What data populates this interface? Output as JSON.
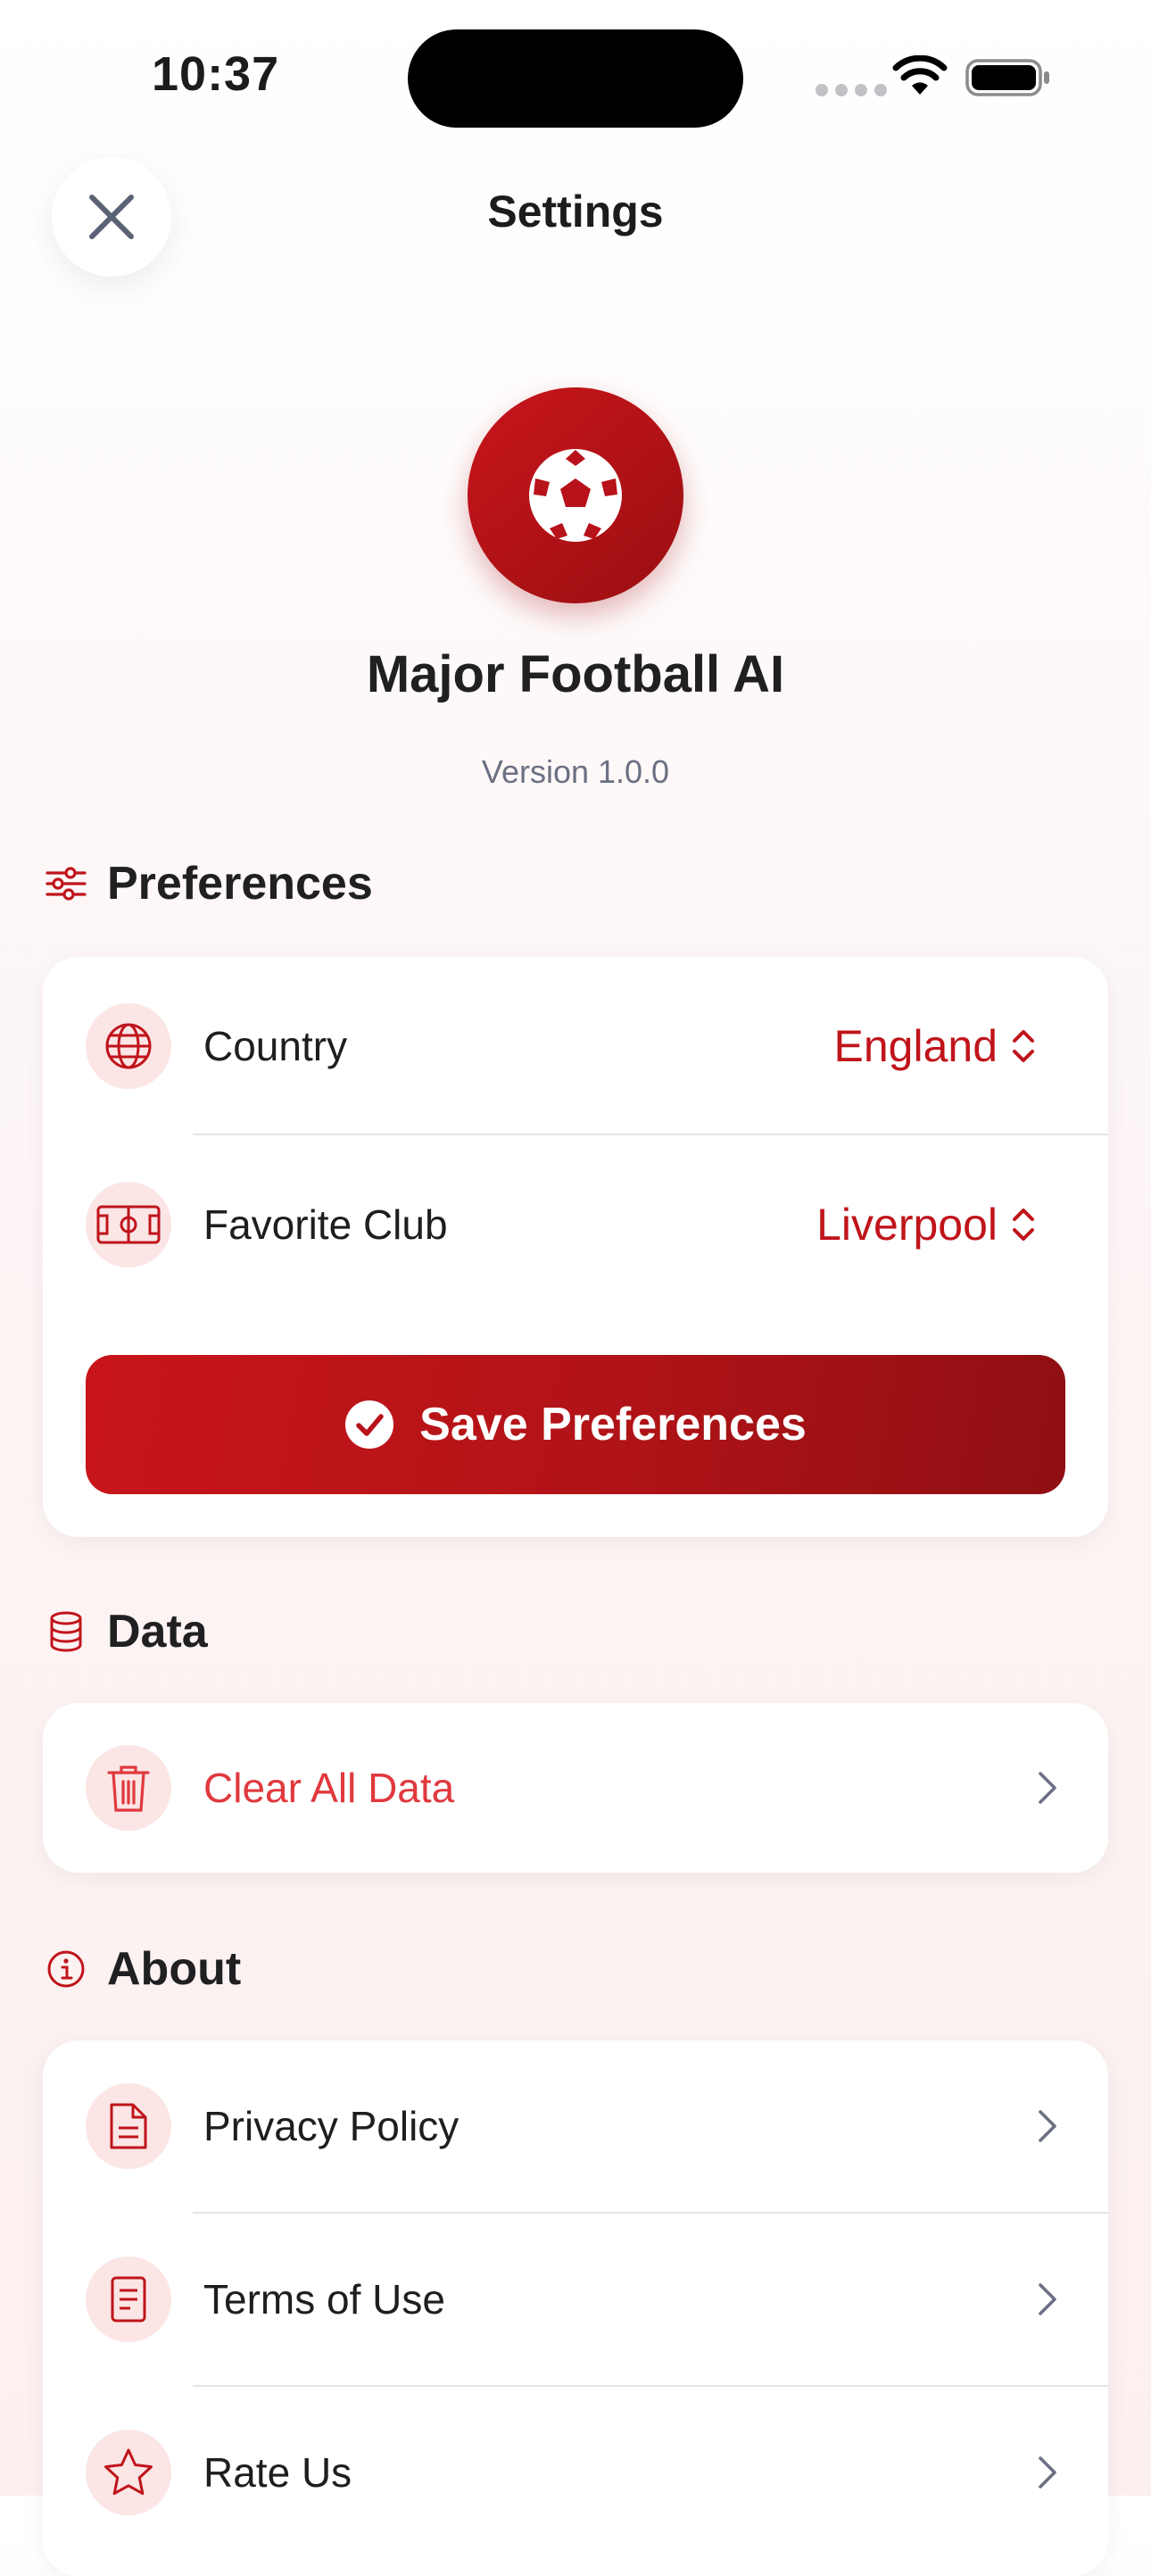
{
  "status_bar": {
    "time": "10:37",
    "icons": [
      "signal-dots",
      "wifi-icon",
      "battery-icon"
    ]
  },
  "nav": {
    "title": "Settings",
    "close_icon": "close-icon"
  },
  "app": {
    "name": "Major Football AI",
    "version": "Version 1.0.0",
    "logo_icon": "soccer-ball-icon"
  },
  "sections": {
    "preferences": {
      "label": "Preferences",
      "icon": "sliders-icon",
      "rows": [
        {
          "label": "Country",
          "value": "England",
          "icon": "globe-icon"
        },
        {
          "label": "Favorite Club",
          "value": "Liverpool",
          "icon": "pitch-icon"
        }
      ],
      "save_label": "Save Preferences"
    },
    "data": {
      "label": "Data",
      "icon": "database-icon",
      "rows": [
        {
          "label": "Clear All Data",
          "icon": "trash-icon"
        }
      ]
    },
    "about": {
      "label": "About",
      "icon": "info-icon",
      "rows": [
        {
          "label": "Privacy Policy",
          "icon": "document-icon"
        },
        {
          "label": "Terms of Use",
          "icon": "terms-icon"
        },
        {
          "label": "Rate Us",
          "icon": "star-icon"
        }
      ]
    }
  },
  "colors": {
    "accent": "#c0141b",
    "accent_dark": "#8f0f12",
    "destructive": "#e0393e",
    "icon_bg": "#fbe5e5",
    "secondary_text": "#6b7083"
  }
}
